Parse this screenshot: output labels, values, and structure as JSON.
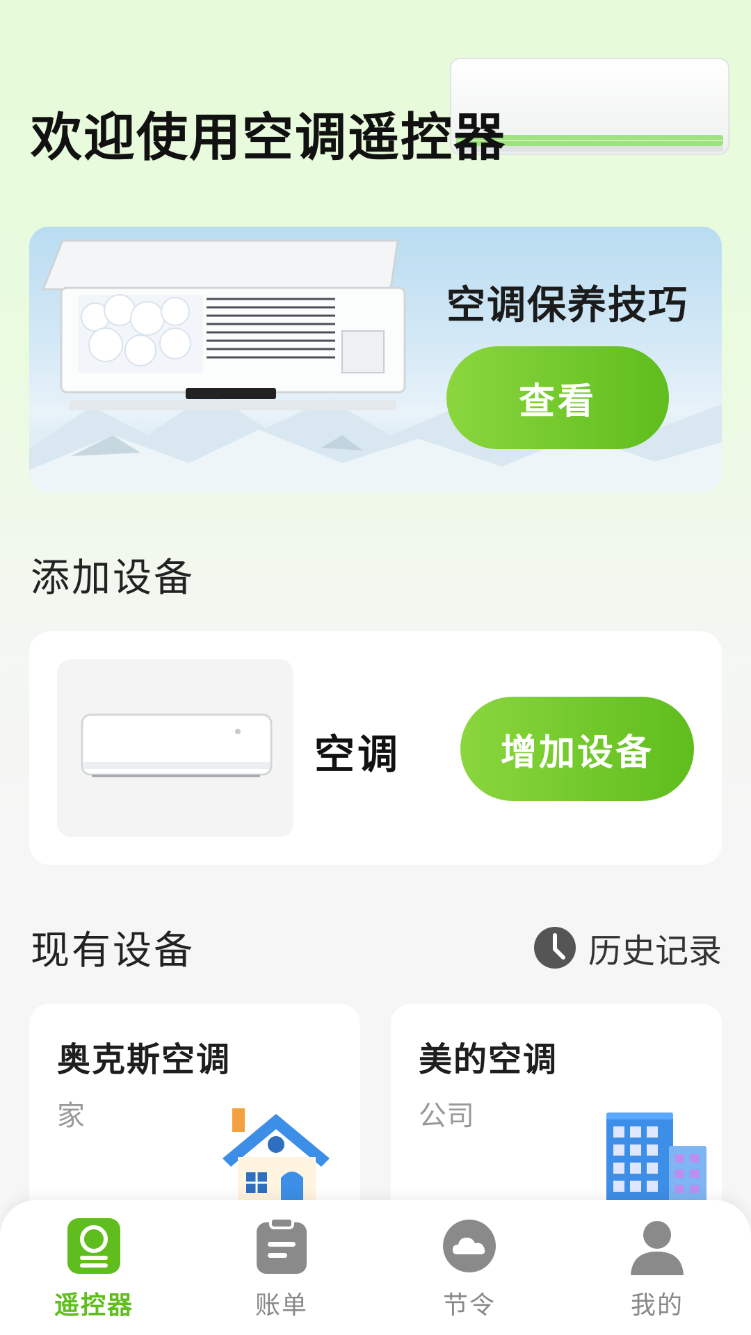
{
  "header": {
    "title": "欢迎使用空调遥控器"
  },
  "banner": {
    "title": "空调保养技巧",
    "button_label": "查看"
  },
  "add_section": {
    "title": "添加设备",
    "device_label": "空调",
    "button_label": "增加设备"
  },
  "existing_section": {
    "title": "现有设备",
    "history_label": "历史记录"
  },
  "devices": [
    {
      "name": "奥克斯空调",
      "location": "家",
      "icon": "house-icon"
    },
    {
      "name": "美的空调",
      "location": "公司",
      "icon": "office-building-icon"
    }
  ],
  "nav": {
    "items": [
      {
        "label": "遥控器",
        "icon": "remote-icon",
        "active": true
      },
      {
        "label": "账单",
        "icon": "clipboard-icon",
        "active": false
      },
      {
        "label": "节令",
        "icon": "weather-cloud-icon",
        "active": false
      },
      {
        "label": "我的",
        "icon": "person-icon",
        "active": false
      }
    ]
  },
  "colors": {
    "accent": "#5fbd1d",
    "accent_light": "#8ad63e",
    "inactive": "#888888"
  }
}
